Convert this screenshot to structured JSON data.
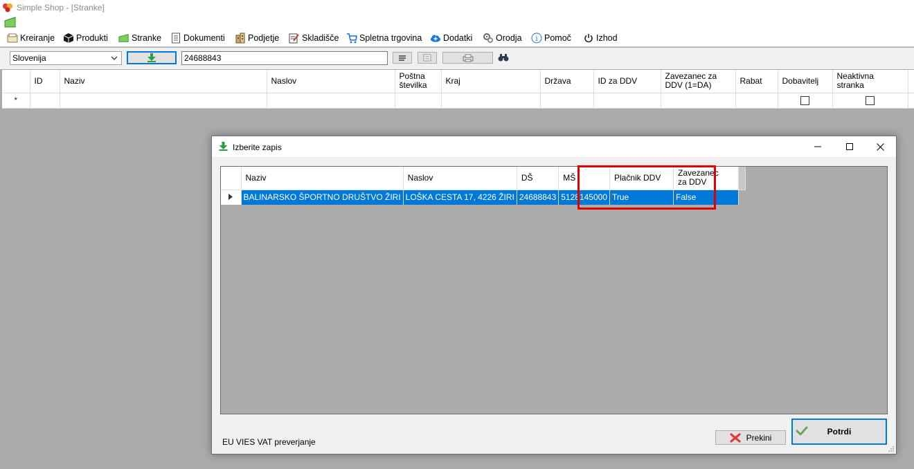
{
  "app": {
    "title": "Simple Shop - [Stranke]"
  },
  "menu": {
    "items": [
      {
        "label": "Kreiranje",
        "icon": "create-icon"
      },
      {
        "label": "Produkti",
        "icon": "box-icon"
      },
      {
        "label": "Stranke",
        "icon": "customers-icon"
      },
      {
        "label": "Dokumenti",
        "icon": "document-icon"
      },
      {
        "label": "Podjetje",
        "icon": "building-icon"
      },
      {
        "label": "Skladišče",
        "icon": "edit-icon"
      },
      {
        "label": "Spletna trgovina",
        "icon": "cart-icon"
      },
      {
        "label": "Dodatki",
        "icon": "cloud-icon"
      },
      {
        "label": "Orodja",
        "icon": "tools-icon"
      },
      {
        "label": "Pomoč",
        "icon": "info-icon"
      },
      {
        "label": "Izhod",
        "icon": "power-icon"
      }
    ]
  },
  "toolbar": {
    "country": "Slovenija",
    "vat_value": "24688843"
  },
  "customers_grid": {
    "columns": [
      "ID",
      "Naziv",
      "Naslov",
      "Poštna številka",
      "Kraj",
      "Država",
      "ID za DDV",
      "Zavezanec za DDV (1=DA)",
      "Rabat",
      "Dobavitelj",
      "Neaktivna stranka"
    ],
    "new_row_marker": "*"
  },
  "dialog": {
    "title": "Izberite zapis",
    "columns": [
      "Naziv",
      "Naslov",
      "DŠ",
      "MŠ",
      "Plačnik DDV",
      "Zavezanec za DDV"
    ],
    "rows": [
      {
        "naziv": "BALINARSKO ŠPORTNO DRUŠTVO ŽIRI",
        "naslov": "LOŠKA CESTA 17, 4226 ŽIRI",
        "ds": "24688843",
        "ms": "5128145000",
        "placnik": "True",
        "zavezanec": "False"
      }
    ],
    "status": "EU VIES VAT preverjanje",
    "cancel_label": "Prekini",
    "confirm_label": "Potrdi"
  },
  "colors": {
    "selection": "#0078d7",
    "highlight": "#e00000",
    "workspace": "#ababab"
  }
}
